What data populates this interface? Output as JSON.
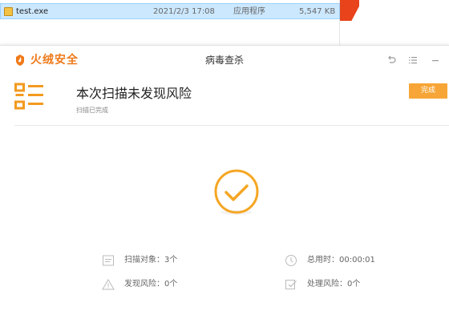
{
  "explorer": {
    "file_name": "test.exe",
    "modified": "2021/2/3 17:08",
    "type": "应用程序",
    "size": "5,547 KB"
  },
  "dialog": {
    "brand": "火绒安全",
    "title": "病毒查杀",
    "headline": "本次扫描未发现风险",
    "subline": "扫描已完成",
    "done_label": "完成",
    "stats": {
      "scanned_objects": "扫描对象：3个",
      "total_time": "总用时：00:00:01",
      "risks_found": "发现风险：0个",
      "risks_handled": "处理风险：0个"
    }
  },
  "colors": {
    "accent": "#f7a536",
    "brand": "#ef7a1a",
    "selection": "#cce8ff"
  }
}
